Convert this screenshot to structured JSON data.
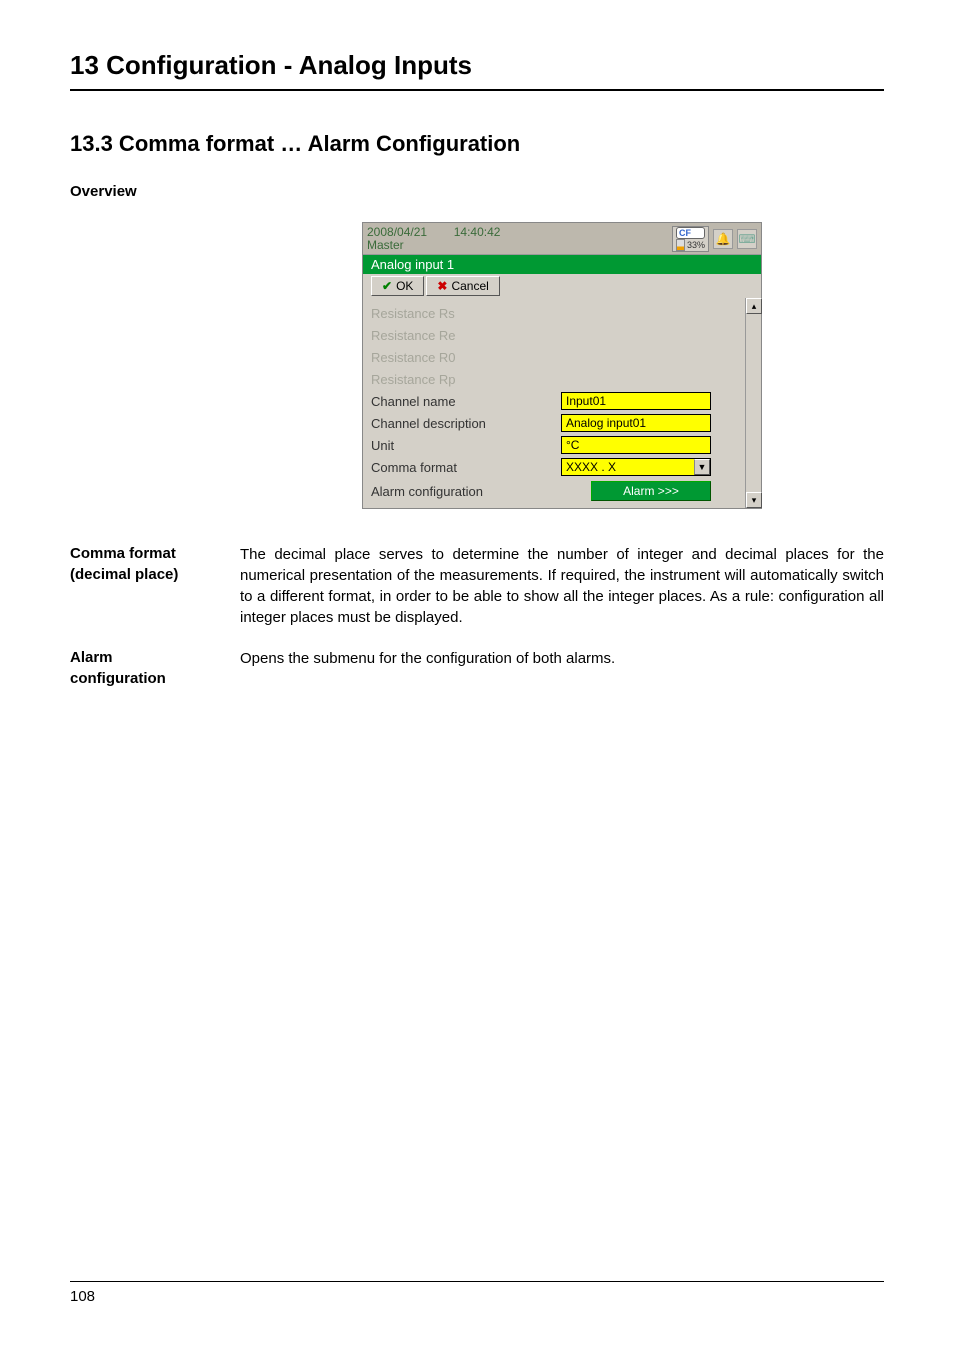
{
  "chapter_title": "13 Configuration - Analog Inputs",
  "section_title": "13.3   Comma format … Alarm Configuration",
  "overview_label": "Overview",
  "screenshot": {
    "titlebar": {
      "date": "2008/04/21",
      "time": "14:40:42",
      "master": "Master",
      "cf_label": "CF",
      "cf_percent": "33%"
    },
    "tab_title": "Analog input 1",
    "buttons": {
      "ok": "OK",
      "cancel": "Cancel"
    },
    "rows": {
      "res_rs": "Resistance Rs",
      "res_re": "Resistance Re",
      "res_r0": "Resistance R0",
      "res_rp": "Resistance Rp",
      "channel_name_label": "Channel name",
      "channel_name_value": "Input01",
      "channel_desc_label": "Channel description",
      "channel_desc_value": "Analog input01",
      "unit_label": "Unit",
      "unit_value": "°C",
      "comma_format_label": "Comma format",
      "comma_format_value": "XXXX . X",
      "alarm_config_label": "Alarm configuration",
      "alarm_btn": "Alarm >>>"
    }
  },
  "comma_section": {
    "label_line1": "Comma format",
    "label_line2": "(decimal place)",
    "text": "The decimal place serves to determine the number of integer and decimal places for the numerical presentation of the measurements. If required, the instrument will automatically switch to a different format, in order to be able to show all the integer places. As a rule: configuration all integer places must be displayed."
  },
  "alarm_section": {
    "label_line1": "Alarm",
    "label_line2": "configuration",
    "text": "Opens the submenu for the configuration of both alarms."
  },
  "page_number": "108"
}
